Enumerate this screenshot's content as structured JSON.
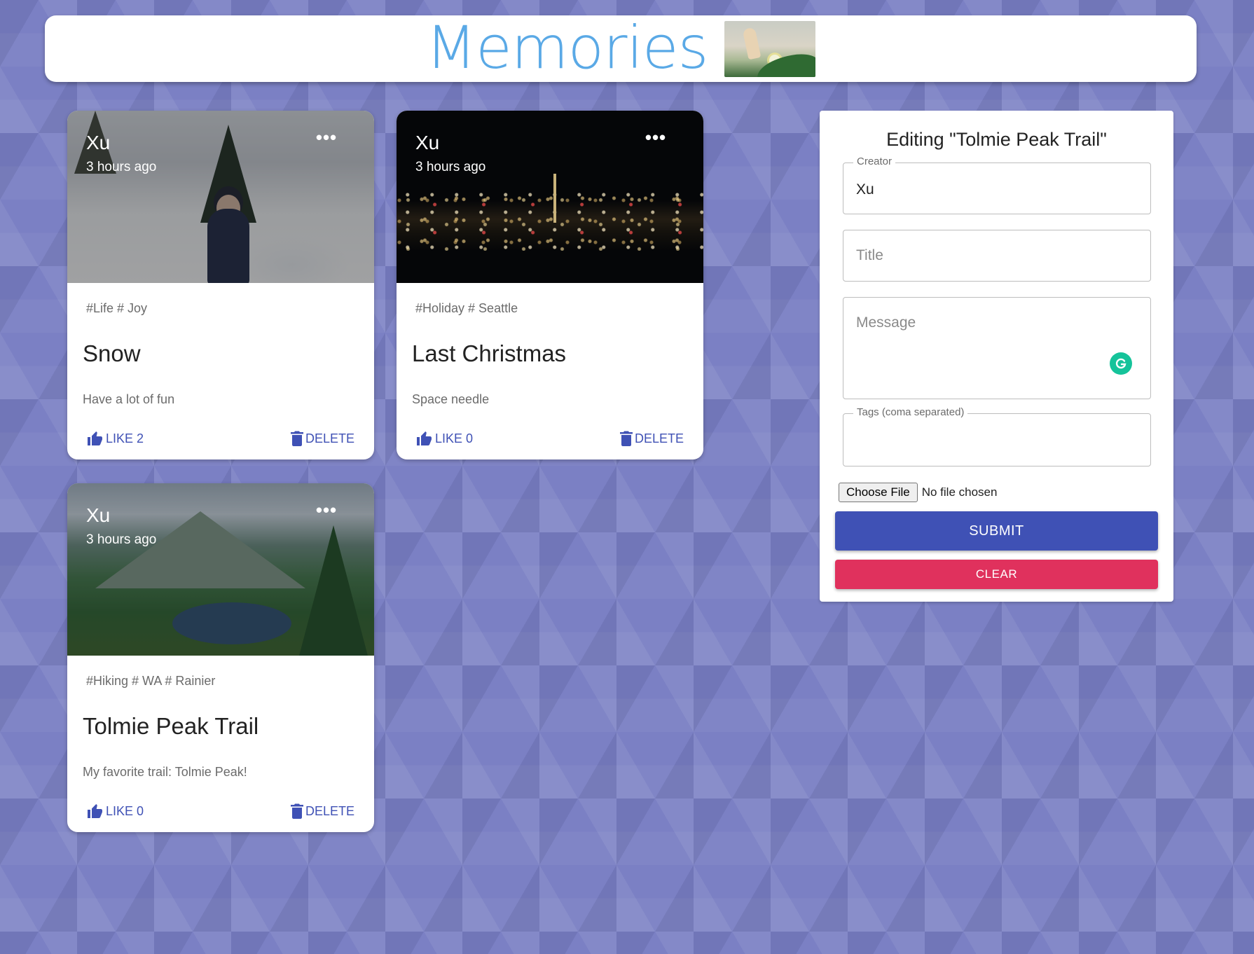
{
  "app": {
    "brand": "Memories",
    "brand_image_icon": "girl-in-meadow-illustration"
  },
  "posts": [
    {
      "creator": "Xu",
      "time": "3 hours ago",
      "tags": "#Life # Joy",
      "title": "Snow",
      "message": "Have a lot of fun",
      "like_label": "LIKE 2",
      "delete_label": "DELETE",
      "more_label": "•••"
    },
    {
      "creator": "Xu",
      "time": "3 hours ago",
      "tags": "#Holiday # Seattle",
      "title": "Last Christmas",
      "message": "Space needle",
      "like_label": "LIKE 0",
      "delete_label": "DELETE",
      "more_label": "•••"
    },
    {
      "creator": "Xu",
      "time": "3 hours ago",
      "tags": "#Hiking # WA # Rainier",
      "title": "Tolmie Peak Trail",
      "message": "My favorite trail: Tolmie Peak!",
      "like_label": "LIKE 0",
      "delete_label": "DELETE",
      "more_label": "•••"
    }
  ],
  "form": {
    "heading": "Editing \"Tolmie Peak Trail\"",
    "creator_label": "Creator",
    "creator_value": "Xu",
    "title_placeholder": "Title",
    "message_placeholder": "Message",
    "tags_label": "Tags (coma separated)",
    "file_button": "Choose File",
    "file_status": "No file chosen",
    "submit_label": "SUBMIT",
    "clear_label": "CLEAR"
  },
  "colors": {
    "brand": "#5aa9e6",
    "primary": "#3f51b5",
    "secondary": "#e0315d",
    "background": "#7b80c4",
    "grammarly": "#15c39a"
  }
}
